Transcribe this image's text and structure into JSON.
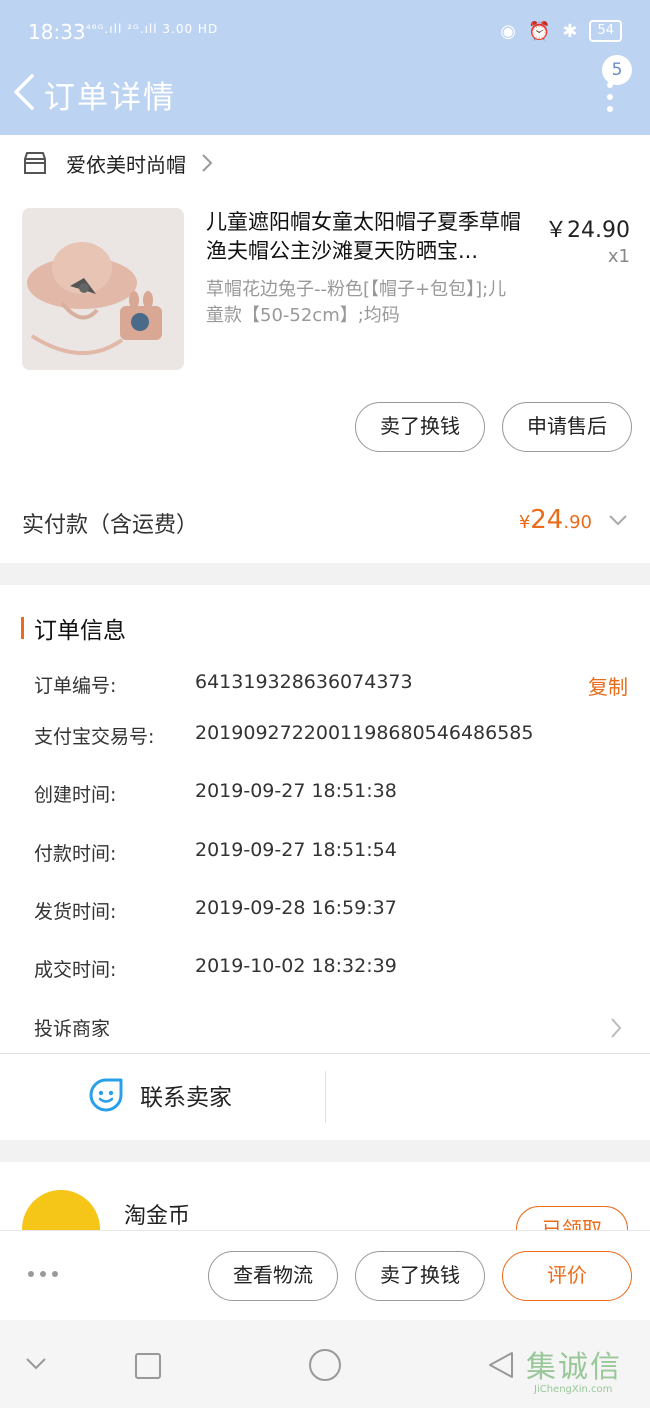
{
  "status_bar": {
    "time": "18:33",
    "signal": "⁴⁶ᴳ.ıll ²ᴳ.ıll 3.00 HD",
    "battery": "54"
  },
  "header": {
    "title": "订单详情",
    "badge": "5"
  },
  "shop": {
    "name": "爱依美时尚帽"
  },
  "product": {
    "title": "儿童遮阳帽女童太阳帽子夏季草帽渔夫帽公主沙滩夏天防晒宝...",
    "price": "￥24.90",
    "qty": "x1",
    "spec": "草帽花边兔子--粉色[【帽子+包包】];儿童款【50-52cm】;均码"
  },
  "product_actions": {
    "sell_label": "卖了换钱",
    "after_sale_label": "申请售后"
  },
  "payment": {
    "label": "实付款（含运费）",
    "currency": "¥",
    "integer": "24",
    "decimal": ".90"
  },
  "order_info": {
    "title": "订单信息",
    "copy_label": "复制",
    "rows": [
      {
        "label": "订单编号:",
        "value": "641319328636074373"
      },
      {
        "label": "支付宝交易号:",
        "value": "2019092722001198680546486585"
      },
      {
        "label": "创建时间:",
        "value": "2019-09-27 18:51:38"
      },
      {
        "label": "付款时间:",
        "value": "2019-09-27 18:51:54"
      },
      {
        "label": "发货时间:",
        "value": "2019-09-28 16:59:37"
      },
      {
        "label": "成交时间:",
        "value": "2019-10-02 18:32:39"
      }
    ],
    "complain_label": "投诉商家",
    "contact_label": "联系卖家"
  },
  "coin": {
    "title": "淘金币",
    "button": "已领取"
  },
  "bottom_actions": {
    "logistics_label": "查看物流",
    "sell_label": "卖了换钱",
    "review_label": "评价"
  },
  "watermark": {
    "text": "集诚信",
    "sub": "JiChengXin.com"
  },
  "colors": {
    "accent": "#ea6b1a",
    "header_bg": "#bdd3f2"
  }
}
